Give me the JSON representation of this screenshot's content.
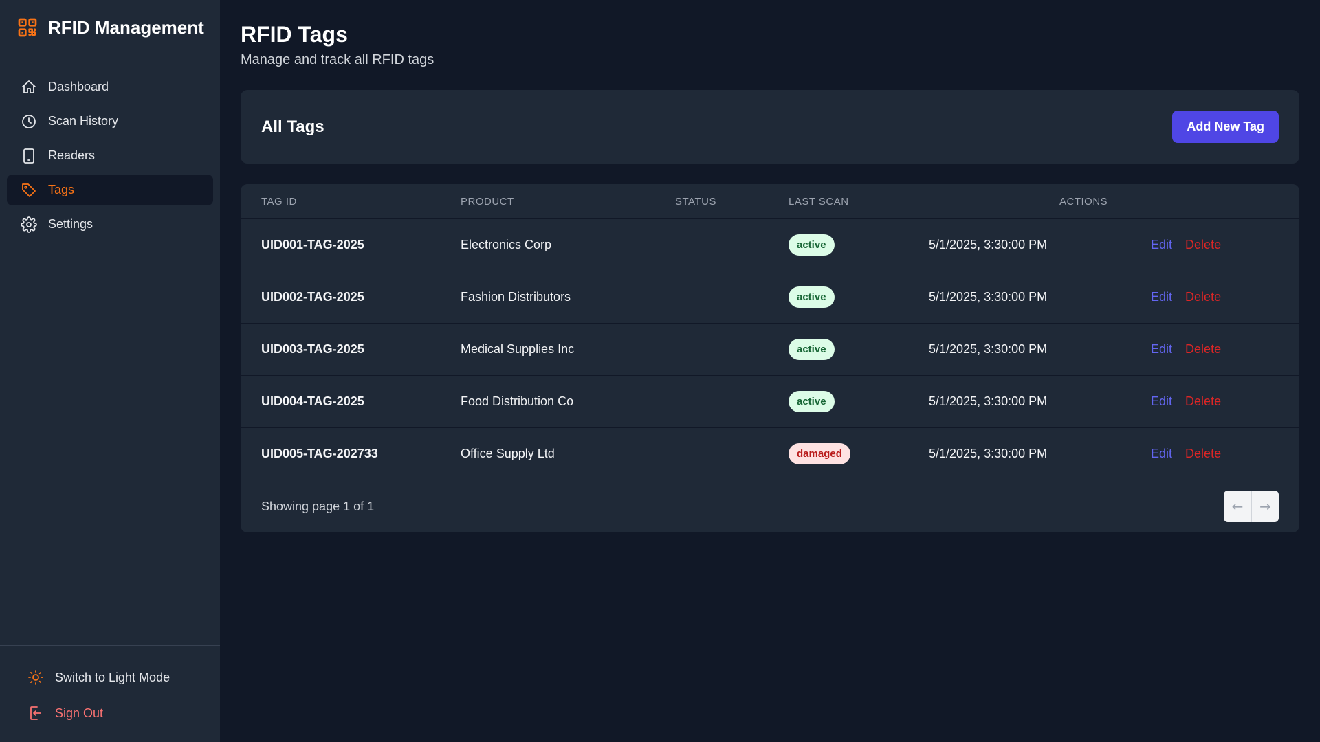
{
  "app": {
    "title": "RFID Management",
    "logo_icon": "qr-code-icon",
    "accent": "#f97316"
  },
  "sidebar": {
    "items": [
      {
        "label": "Dashboard",
        "icon": "home-icon"
      },
      {
        "label": "Scan History",
        "icon": "clock-icon"
      },
      {
        "label": "Readers",
        "icon": "tablet-icon"
      },
      {
        "label": "Tags",
        "icon": "tag-icon",
        "active": true
      },
      {
        "label": "Settings",
        "icon": "gear-icon"
      }
    ],
    "footer": {
      "theme_label": "Switch to Light Mode",
      "signout_label": "Sign Out"
    }
  },
  "page": {
    "title": "RFID Tags",
    "subtitle": "Manage and track all RFID tags"
  },
  "card": {
    "title": "All Tags",
    "add_button": "Add New Tag"
  },
  "table": {
    "headers": [
      "TAG ID",
      "PRODUCT",
      "STATUS",
      "LAST SCAN",
      "ACTIONS"
    ],
    "rows": [
      {
        "tag_id": "UID001-TAG-2025",
        "product": "Electronics Corp",
        "status": "active",
        "last_scan": "5/1/2025, 3:30:00 PM"
      },
      {
        "tag_id": "UID002-TAG-2025",
        "product": "Fashion Distributors",
        "status": "active",
        "last_scan": "5/1/2025, 3:30:00 PM"
      },
      {
        "tag_id": "UID003-TAG-2025",
        "product": "Medical Supplies Inc",
        "status": "active",
        "last_scan": "5/1/2025, 3:30:00 PM"
      },
      {
        "tag_id": "UID004-TAG-2025",
        "product": "Food Distribution Co",
        "status": "active",
        "last_scan": "5/1/2025, 3:30:00 PM"
      },
      {
        "tag_id": "UID005-TAG-202733",
        "product": "Office Supply Ltd",
        "status": "damaged",
        "last_scan": "5/1/2025, 3:30:00 PM"
      }
    ],
    "edit_label": "Edit",
    "delete_label": "Delete",
    "footer_text": "Showing page 1 of 1",
    "prev_label": "←",
    "next_label": "→"
  }
}
